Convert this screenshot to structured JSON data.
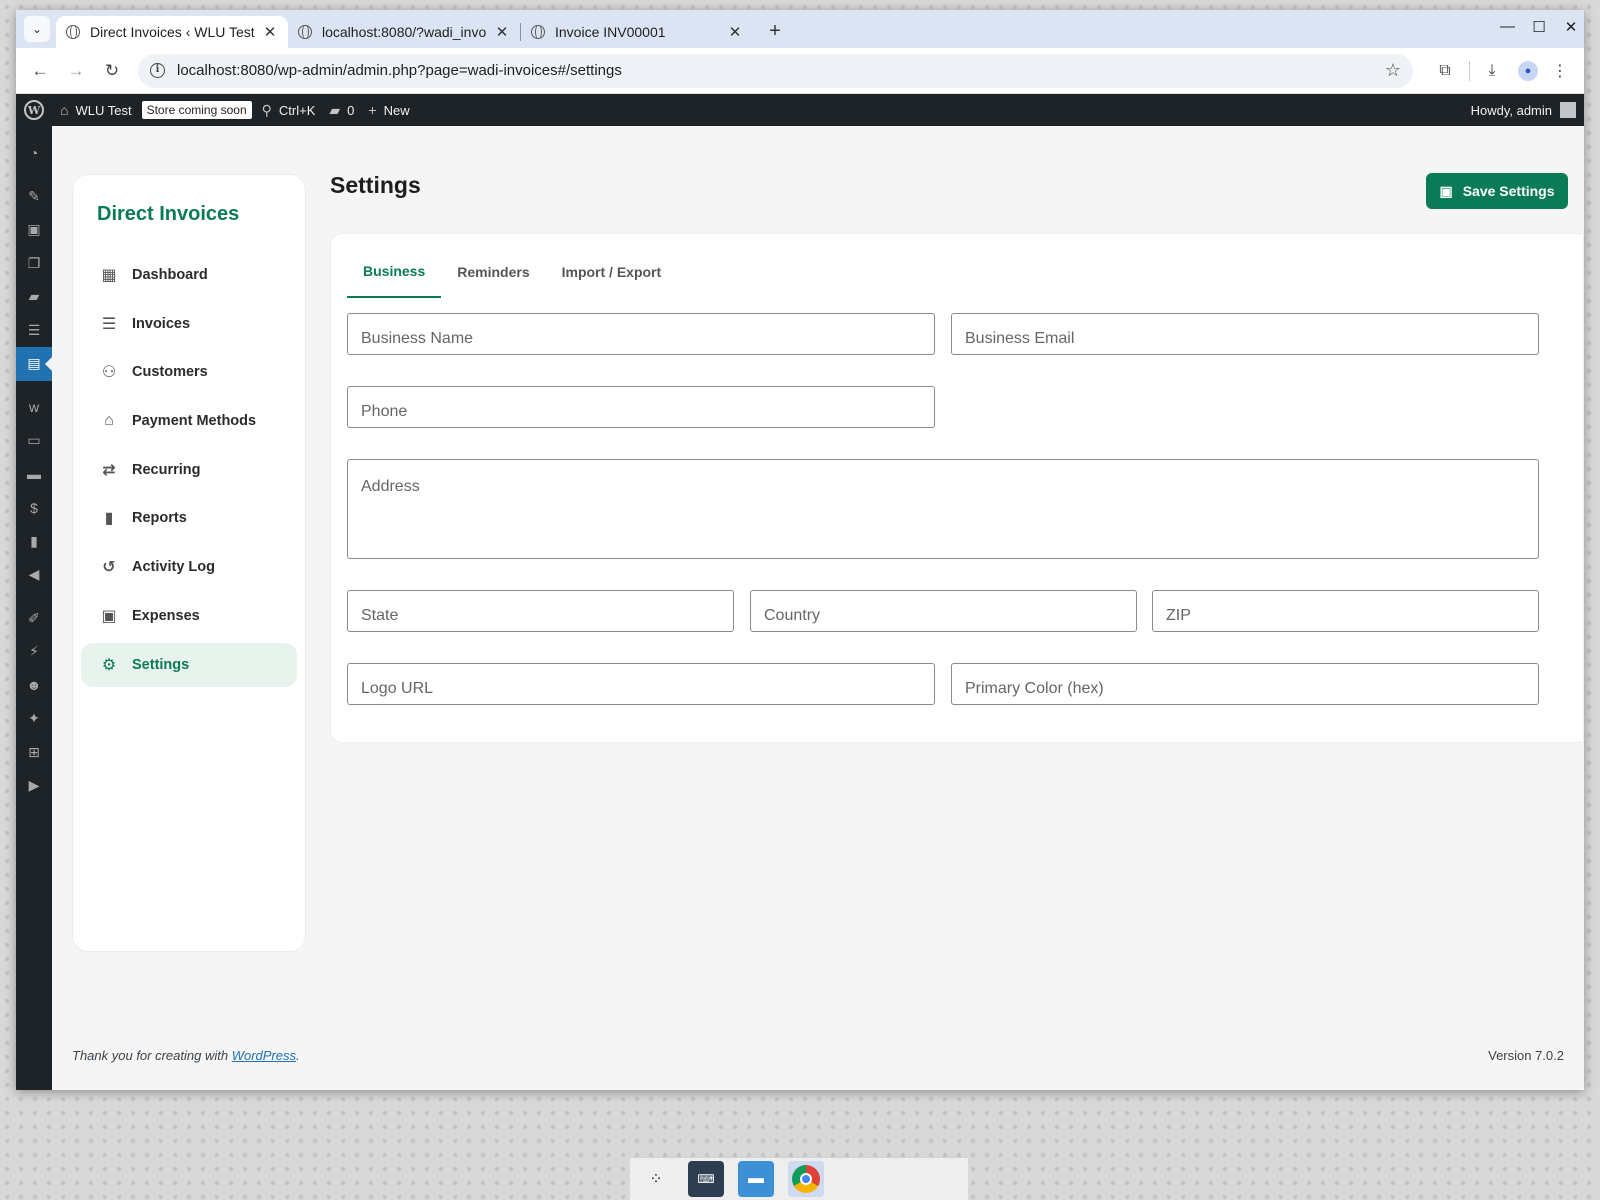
{
  "browser": {
    "tabs": [
      {
        "title": "Direct Invoices ‹ WLU Test",
        "active": true
      },
      {
        "title": "localhost:8080/?wadi_invo",
        "active": false
      },
      {
        "title": "Invoice INV00001",
        "active": false
      }
    ],
    "url": "localhost:8080/wp-admin/admin.php?page=wadi-invoices#/settings"
  },
  "adminbar": {
    "site_name": "WLU Test",
    "store_badge": "Store coming soon",
    "search_shortcut": "Ctrl+K",
    "comments_count": "0",
    "new_label": "New",
    "howdy": "Howdy, admin"
  },
  "plugin": {
    "brand": "Direct Invoices",
    "nav": [
      {
        "label": "Dashboard",
        "icon": "dashboard-icon",
        "active": false
      },
      {
        "label": "Invoices",
        "icon": "invoice-icon",
        "active": false
      },
      {
        "label": "Customers",
        "icon": "people-icon",
        "active": false
      },
      {
        "label": "Payment Methods",
        "icon": "bank-icon",
        "active": false
      },
      {
        "label": "Recurring",
        "icon": "repeat-icon",
        "active": false
      },
      {
        "label": "Reports",
        "icon": "bar-chart-icon",
        "active": false
      },
      {
        "label": "Activity Log",
        "icon": "history-icon",
        "active": false
      },
      {
        "label": "Expenses",
        "icon": "wallet-icon",
        "active": false
      },
      {
        "label": "Settings",
        "icon": "gear-icon",
        "active": true
      }
    ]
  },
  "page": {
    "title": "Settings",
    "save_label": "Save Settings",
    "tabs": [
      "Business",
      "Reminders",
      "Import / Export"
    ],
    "active_tab": "Business",
    "fields": {
      "business_name": "Business Name",
      "business_email": "Business Email",
      "phone": "Phone",
      "address": "Address",
      "state": "State",
      "country": "Country",
      "zip": "ZIP",
      "logo_url": "Logo URL",
      "primary_color": "Primary Color (hex)"
    }
  },
  "footer": {
    "thanks_prefix": "Thank you for creating with ",
    "wordpress_link": "WordPress",
    "thanks_suffix": ".",
    "version": "Version 7.0.2"
  },
  "colors": {
    "accent": "#0a7a57",
    "wp_admin_bar": "#1d2327",
    "wp_active": "#2271b1"
  }
}
